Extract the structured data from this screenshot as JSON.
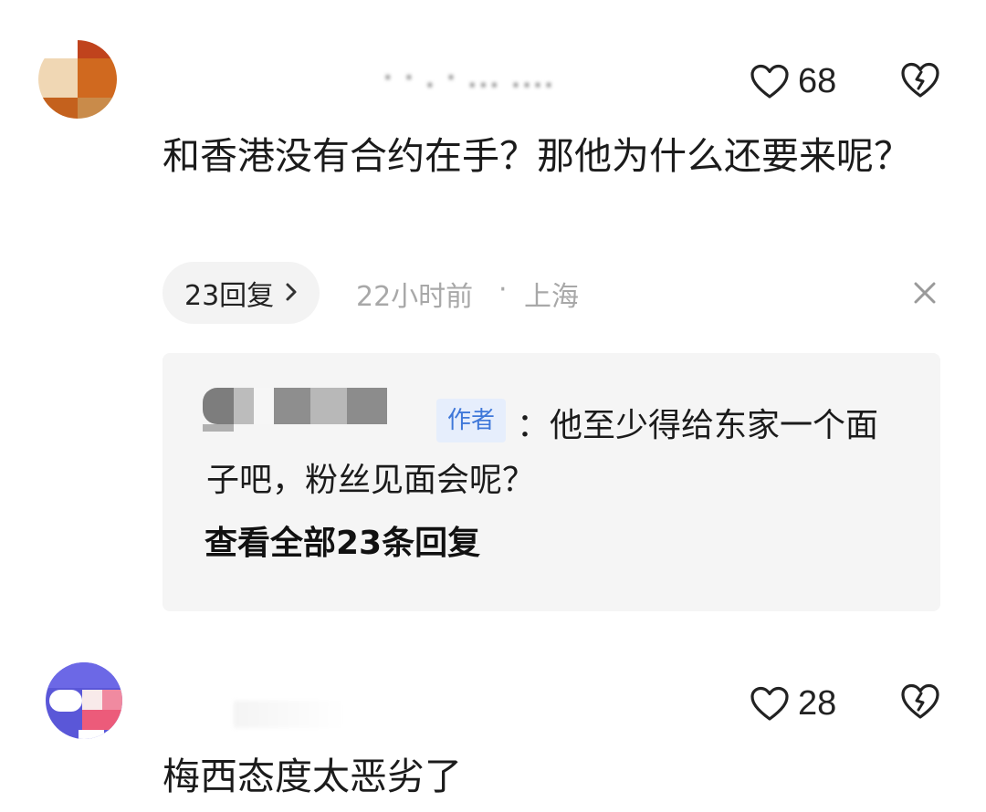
{
  "comments": [
    {
      "username": "· · . · ․․․ ․․․․",
      "like_count": "68",
      "text": "和香港没有合约在手？那他为什么还要来呢？",
      "reply_label": "23回复",
      "time": "22小时前",
      "dot": "·",
      "location": "上海",
      "reply": {
        "author_badge": "作者",
        "text": "：他至少得给东家一个面子吧，粉丝见面会呢？",
        "view_all": "查看全部23条回复"
      }
    },
    {
      "username": "",
      "like_count": "28",
      "text": "梅西态度太恶劣了"
    }
  ],
  "icons": {
    "like": "heart-outline-icon",
    "dislike": "broken-heart-icon",
    "close": "close-icon",
    "chevron": "chevron-right-icon"
  },
  "colors": {
    "text": "#1b1b1b",
    "meta": "#a8a8a8",
    "reply_bg": "#f5f5f5",
    "badge_bg": "#e6eefc",
    "badge_text": "#3f78d9"
  }
}
